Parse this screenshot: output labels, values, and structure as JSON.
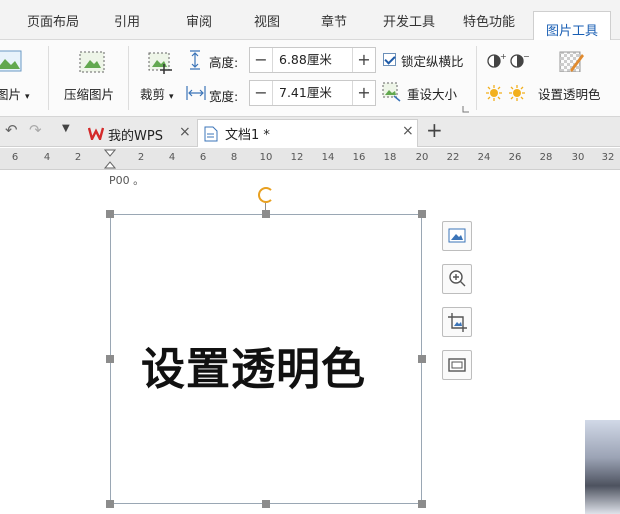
{
  "menu": {
    "tabs": [
      "页面布局",
      "引用",
      "审阅",
      "视图",
      "章节",
      "开发工具",
      "特色功能",
      "图片工具"
    ],
    "active_tab": "图片工具"
  },
  "ribbon": {
    "picture_label": "图片",
    "compress_label": "压缩图片",
    "crop_label": "裁剪",
    "height_label": "高度:",
    "height_value": "6.88厘米",
    "width_label": "宽度:",
    "width_value": "7.41厘米",
    "minus": "−",
    "plus": "+",
    "lock_ratio_label": "锁定纵横比",
    "reset_size_label": "重设大小",
    "set_transparent_label": "设置透明色"
  },
  "tabbar": {
    "wps_tab": "我的WPS",
    "doc_tab": "文档1 *",
    "close": "×",
    "new_tab": "+"
  },
  "ruler": {
    "ticks": [
      "6",
      "4",
      "2",
      "",
      "2",
      "4",
      "6",
      "8",
      "10",
      "12",
      "14",
      "16",
      "18",
      "20",
      "22",
      "24",
      "26",
      "28",
      "30",
      "32"
    ]
  },
  "document": {
    "paragraph_mark": "P00 。",
    "image_text": "设置透明色"
  },
  "colors": {
    "accent": "#2f7bd6",
    "rotate_handle": "#e8a020"
  }
}
